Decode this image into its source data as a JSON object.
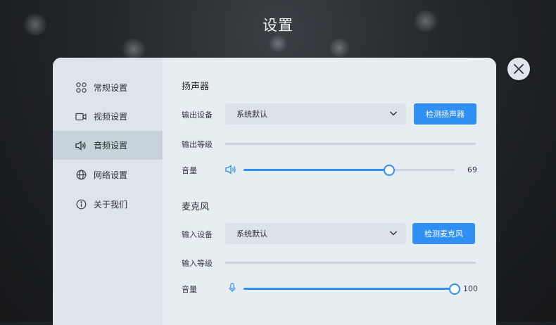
{
  "page": {
    "title": "设置"
  },
  "colors": {
    "accent": "#2f8ff2",
    "panel": "#e7eef2",
    "sidebar": "#dde5ea",
    "sidebar_active": "#c7d3db"
  },
  "sidebar": {
    "items": [
      {
        "label": "常规设置",
        "icon": "grid-icon",
        "active": false
      },
      {
        "label": "视频设置",
        "icon": "video-camera-icon",
        "active": false
      },
      {
        "label": "音频设置",
        "icon": "speaker-icon",
        "active": true
      },
      {
        "label": "网络设置",
        "icon": "globe-icon",
        "active": false
      },
      {
        "label": "关于我们",
        "icon": "info-icon",
        "active": false
      }
    ]
  },
  "speaker": {
    "section_title": "扬声器",
    "output_device_label": "输出设备",
    "output_device_value": "系统默认",
    "test_button": "检测扬声器",
    "output_level_label": "输出等级",
    "volume_label": "音量",
    "volume_value": "69",
    "volume_fraction": 0.69
  },
  "microphone": {
    "section_title": "麦克风",
    "input_device_label": "输入设备",
    "input_device_value": "系统默认",
    "test_button": "检测麦克风",
    "input_level_label": "输入等级",
    "volume_label": "音量",
    "volume_value": "100",
    "volume_fraction": 1.0
  }
}
